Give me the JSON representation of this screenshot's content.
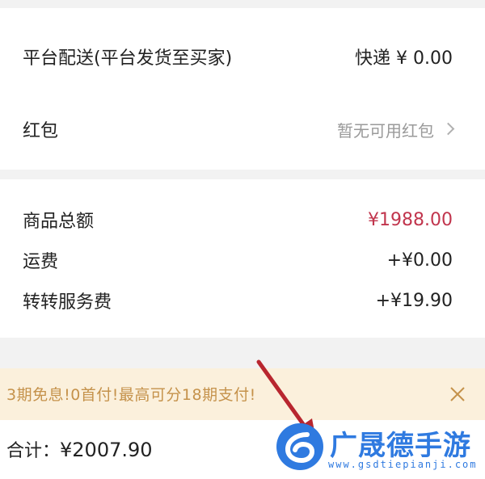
{
  "delivery": {
    "label": "平台配送(平台发货至买家)",
    "value": "快递 ¥ 0.00"
  },
  "red_packet": {
    "label": "红包",
    "value": "暂无可用红包"
  },
  "summary": {
    "rows": [
      {
        "label": "商品总额",
        "value": "¥1988.00"
      },
      {
        "label": "运费",
        "value": "+¥0.00"
      },
      {
        "label": "转转服务费",
        "value": "+¥19.90"
      }
    ]
  },
  "promo": {
    "text": "3期免息!0首付!最高可分18期支付!"
  },
  "bottom_bar": {
    "total_label": "合计：",
    "total_value": "¥2007.90"
  },
  "watermark": {
    "title": "广晟德手游",
    "url": "www.gsdtiepianji.com"
  },
  "colors": {
    "accent_red": "#c1354d",
    "promo_text": "#c5924b",
    "promo_bg": "#fbf0dc",
    "watermark_blue": "#2f7ae0"
  }
}
